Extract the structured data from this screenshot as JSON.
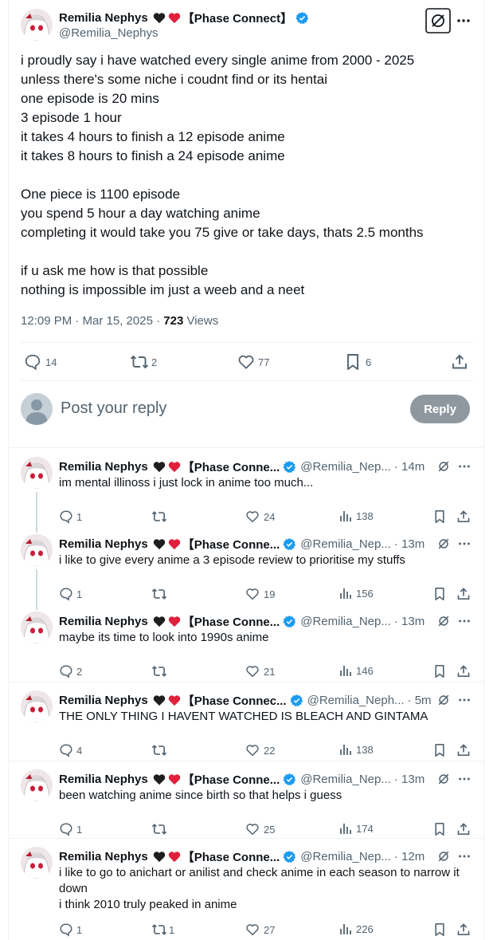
{
  "main_tweet": {
    "author_name": "Remilia Nephys",
    "author_tag": "【Phase Connect】",
    "handle": "@Remilia_Nephys",
    "text": "i proudly say i have watched every single anime from 2000 - 2025\nunless there's some niche i coudnt find or its hentai\none episode is 20 mins\n3 episode 1 hour\nit takes 4 hours to finish a 12 episode anime\nit takes 8 hours to finish a 24 episode anime\n\nOne piece is 1100 episode\nyou spend 5 hour a day watching anime\ncompleting it would take you 75 give or take days, thats 2.5 months\n\nif u ask me how is that possible\nnothing is impossible im just a weeb and a neet",
    "time": "12:09 PM · Mar 15, 2025 · ",
    "views_count": "723",
    "views_label": " Views",
    "stats": {
      "replies": "14",
      "reposts": "2",
      "likes": "77",
      "bookmarks": "6"
    }
  },
  "composer": {
    "placeholder": "Post your reply",
    "button": "Reply"
  },
  "replies": [
    {
      "name": "Remilia Nephys",
      "tag": "【Phase Conne...",
      "handle": "@Remilia_Nep...",
      "time": "· 14m",
      "text": "im mental illinoss i just lock in anime too much...",
      "replies": "1",
      "reposts": "",
      "likes": "24",
      "views": "138"
    },
    {
      "name": "Remilia Nephys",
      "tag": "【Phase Conne...",
      "handle": "@Remilia_Nep...",
      "time": "· 13m",
      "text": "i like to give every anime a 3 episode review to prioritise my stuffs",
      "replies": "1",
      "reposts": "",
      "likes": "19",
      "views": "156"
    },
    {
      "name": "Remilia Nephys",
      "tag": "【Phase Conne...",
      "handle": "@Remilia_Nep...",
      "time": "· 13m",
      "text": "maybe its time to look into 1990s anime",
      "replies": "2",
      "reposts": "",
      "likes": "21",
      "views": "146"
    },
    {
      "name": "Remilia Nephys",
      "tag": "【Phase Connec...",
      "handle": "@Remilia_Neph...",
      "time": "· 5m",
      "text": "THE ONLY THING I HAVENT WATCHED IS BLEACH AND GINTAMA",
      "replies": "4",
      "reposts": "",
      "likes": "22",
      "views": "138"
    },
    {
      "name": "Remilia Nephys",
      "tag": "【Phase Conne...",
      "handle": "@Remilia_Nep...",
      "time": "· 13m",
      "text": "been watching anime since birth so that helps i guess",
      "replies": "1",
      "reposts": "",
      "likes": "25",
      "views": "174"
    },
    {
      "name": "Remilia Nephys",
      "tag": "【Phase Conne...",
      "handle": "@Remilia_Nep...",
      "time": "· 12m",
      "text": "i like to go to anichart or anilist and check anime in each season to narrow it down\ni think 2010 truly peaked in anime",
      "replies": "1",
      "reposts": "1",
      "likes": "27",
      "views": "226"
    }
  ],
  "colors": {
    "verified": "#1d9bf0",
    "heart": "#f91880",
    "dark_heart": "#1e1e1e",
    "muted": "#536471",
    "reply_button": "#8f989f"
  }
}
